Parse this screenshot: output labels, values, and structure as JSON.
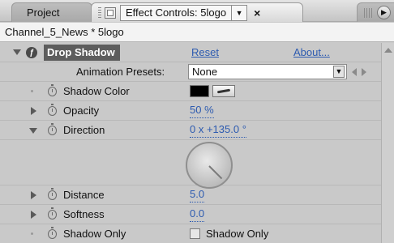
{
  "tabs": {
    "project_label": "Project",
    "effect_controls_label": "Effect Controls: 5logo",
    "menu_glyph": "▼",
    "close_glyph": "×"
  },
  "panel_path": "Channel_5_News * 5logo",
  "effect": {
    "name": "Drop Shadow",
    "reset_label": "Reset",
    "about_label": "About...",
    "presets_label": "Animation Presets:",
    "presets_value": "None",
    "properties": {
      "shadow_color": {
        "label": "Shadow Color",
        "color": "#000000"
      },
      "opacity": {
        "label": "Opacity",
        "value": "50 %"
      },
      "direction": {
        "label": "Direction",
        "value": "0 x +135.0 °",
        "angle_degrees": 135
      },
      "distance": {
        "label": "Distance",
        "value": "5.0"
      },
      "softness": {
        "label": "Softness",
        "value": "0.0"
      },
      "shadow_only": {
        "label": "Shadow Only",
        "checkbox_label": "Shadow Only",
        "checked": false
      }
    }
  },
  "colors": {
    "link": "#2d5bb0",
    "effect_header_bg": "#5d5d5d",
    "panel_bg": "#c9c9c9"
  }
}
